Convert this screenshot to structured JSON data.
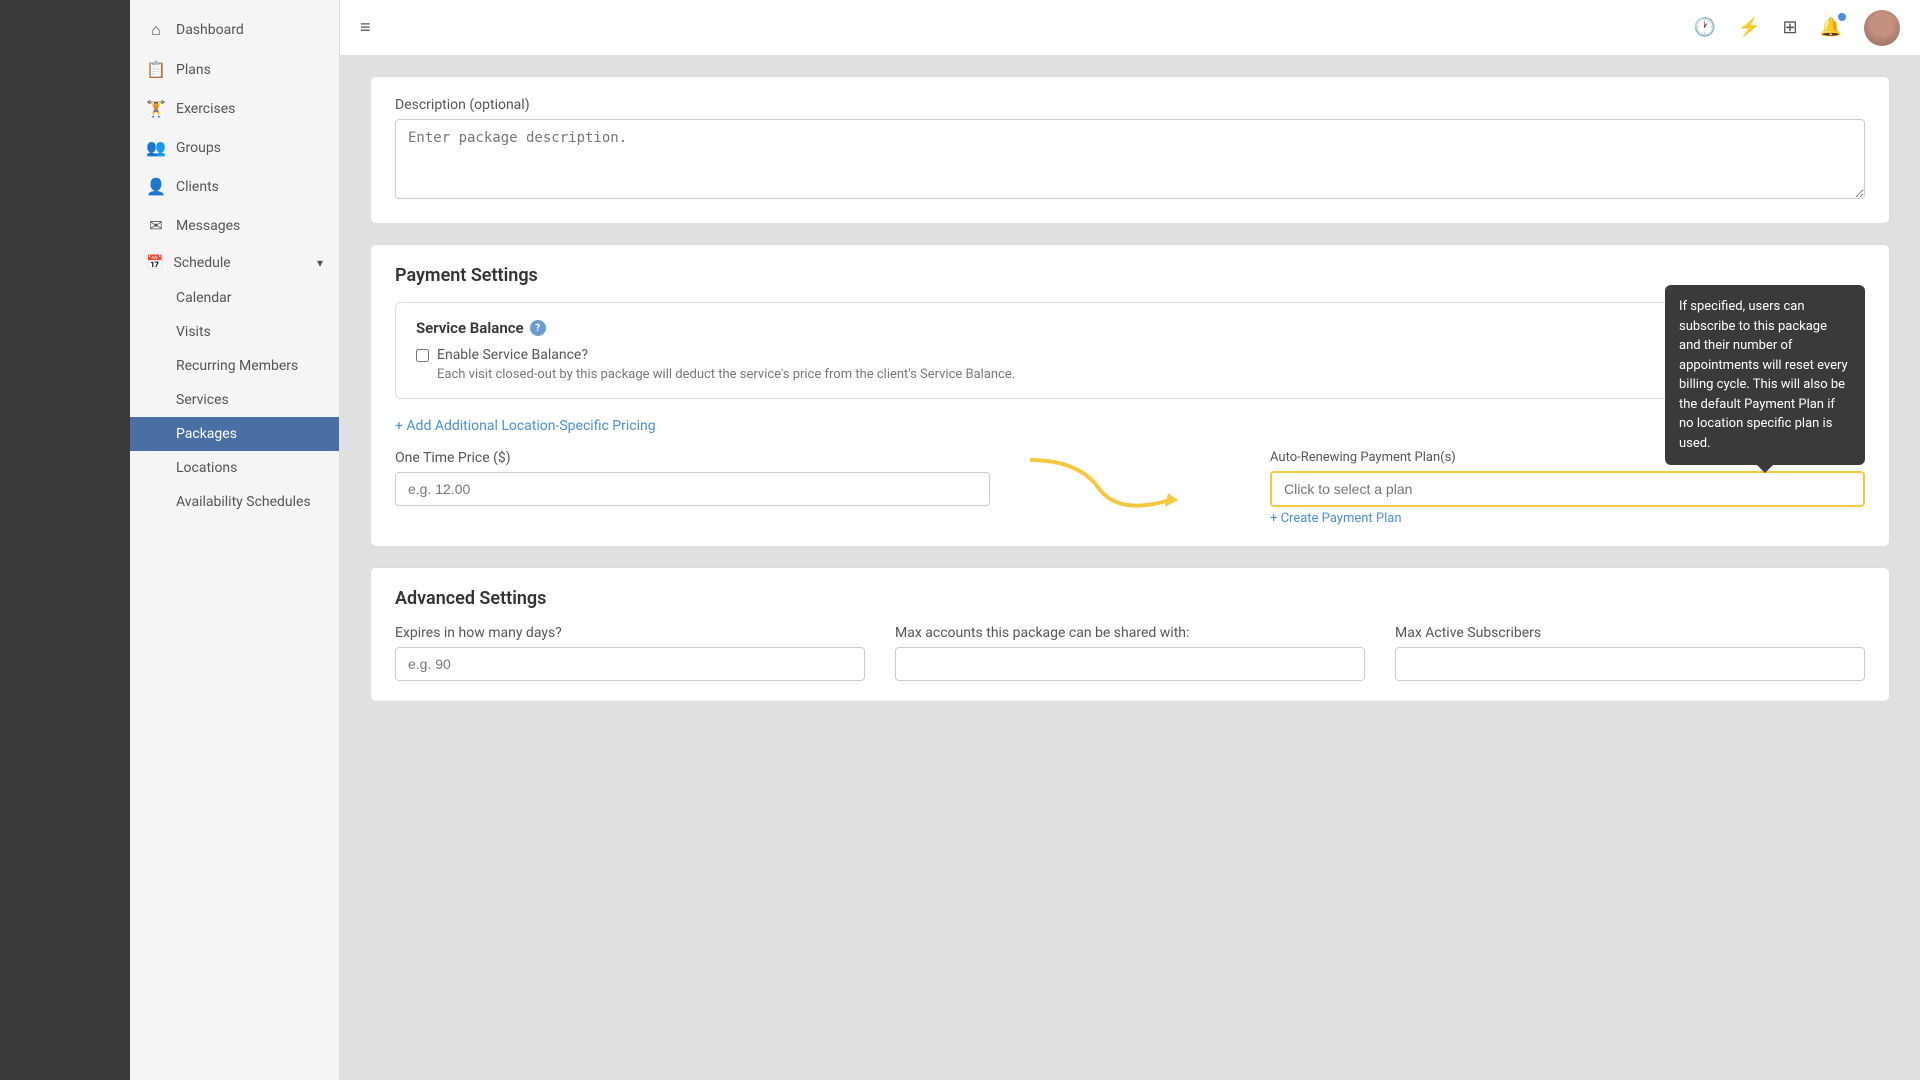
{
  "sidebar": {
    "items": [
      {
        "id": "dashboard",
        "label": "Dashboard",
        "icon": "⌂"
      },
      {
        "id": "plans",
        "label": "Plans",
        "icon": "📋"
      },
      {
        "id": "exercises",
        "label": "Exercises",
        "icon": "🏋"
      },
      {
        "id": "groups",
        "label": "Groups",
        "icon": "👥"
      },
      {
        "id": "clients",
        "label": "Clients",
        "icon": "👤"
      },
      {
        "id": "messages",
        "label": "Messages",
        "icon": "✉"
      }
    ],
    "schedule_label": "Schedule",
    "sub_items": [
      {
        "id": "calendar",
        "label": "Calendar"
      },
      {
        "id": "visits",
        "label": "Visits"
      },
      {
        "id": "recurring_members",
        "label": "Recurring Members"
      },
      {
        "id": "services",
        "label": "Services"
      },
      {
        "id": "packages",
        "label": "Packages",
        "active": true
      },
      {
        "id": "locations",
        "label": "Locations"
      },
      {
        "id": "availability_schedules",
        "label": "Availability Schedules"
      }
    ]
  },
  "topbar": {
    "icons": [
      "history",
      "lightning",
      "grid",
      "bell",
      "avatar"
    ]
  },
  "description_section": {
    "label": "Description (optional)",
    "placeholder": "Enter package description."
  },
  "payment_settings": {
    "title": "Payment Settings",
    "service_balance_title": "Service Balance",
    "enable_checkbox_label": "Enable Service Balance?",
    "enable_checkbox_desc": "Each visit closed-out by this package will deduct the service's price from the client's Service Balance.",
    "add_pricing_label": "+ Add Additional Location-Specific Pricing",
    "one_time_price_label": "One Time Price ($)",
    "one_time_price_placeholder": "e.g. 12.00",
    "auto_renewing_label": "Auto-Renewing Payment Plan(s)",
    "plan_select_placeholder": "Click to select a plan",
    "create_plan_link": "+ Create Payment Plan",
    "tooltip_text": "If specified, users can subscribe to this package and their number of appointments will reset every billing cycle. This will also be the default Payment Plan if no location specific plan is used."
  },
  "advanced_settings": {
    "title": "Advanced Settings",
    "expires_label": "Expires in how many days?",
    "expires_placeholder": "e.g. 90",
    "max_accounts_label": "Max accounts this package can be shared with:",
    "max_subscribers_label": "Max Active Subscribers"
  }
}
